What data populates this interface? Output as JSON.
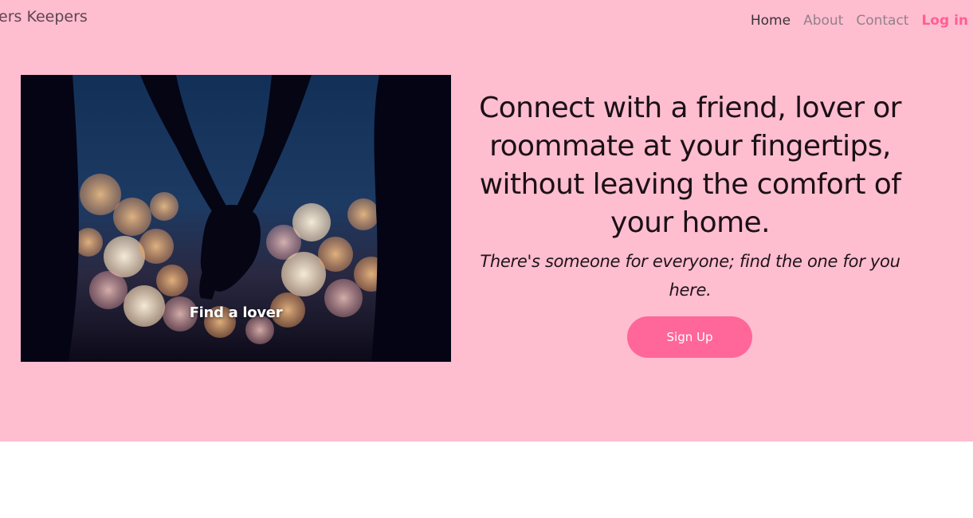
{
  "header": {
    "brand": "ers Keepers",
    "nav": {
      "home": "Home",
      "about": "About",
      "contact": "Contact",
      "login": "Log in"
    }
  },
  "hero": {
    "image_caption": "Find a lover",
    "headline": "Connect with a friend, lover or roommate at your fingertips, without leaving the comfort of your home.",
    "subtext": "There's someone for everyone; find the one for you here.",
    "cta_label": "Sign Up"
  },
  "colors": {
    "hero_background": "#ffbdd0",
    "accent": "#ff6699",
    "login_link": "#ff5e95",
    "page_background": "#ffffff"
  }
}
